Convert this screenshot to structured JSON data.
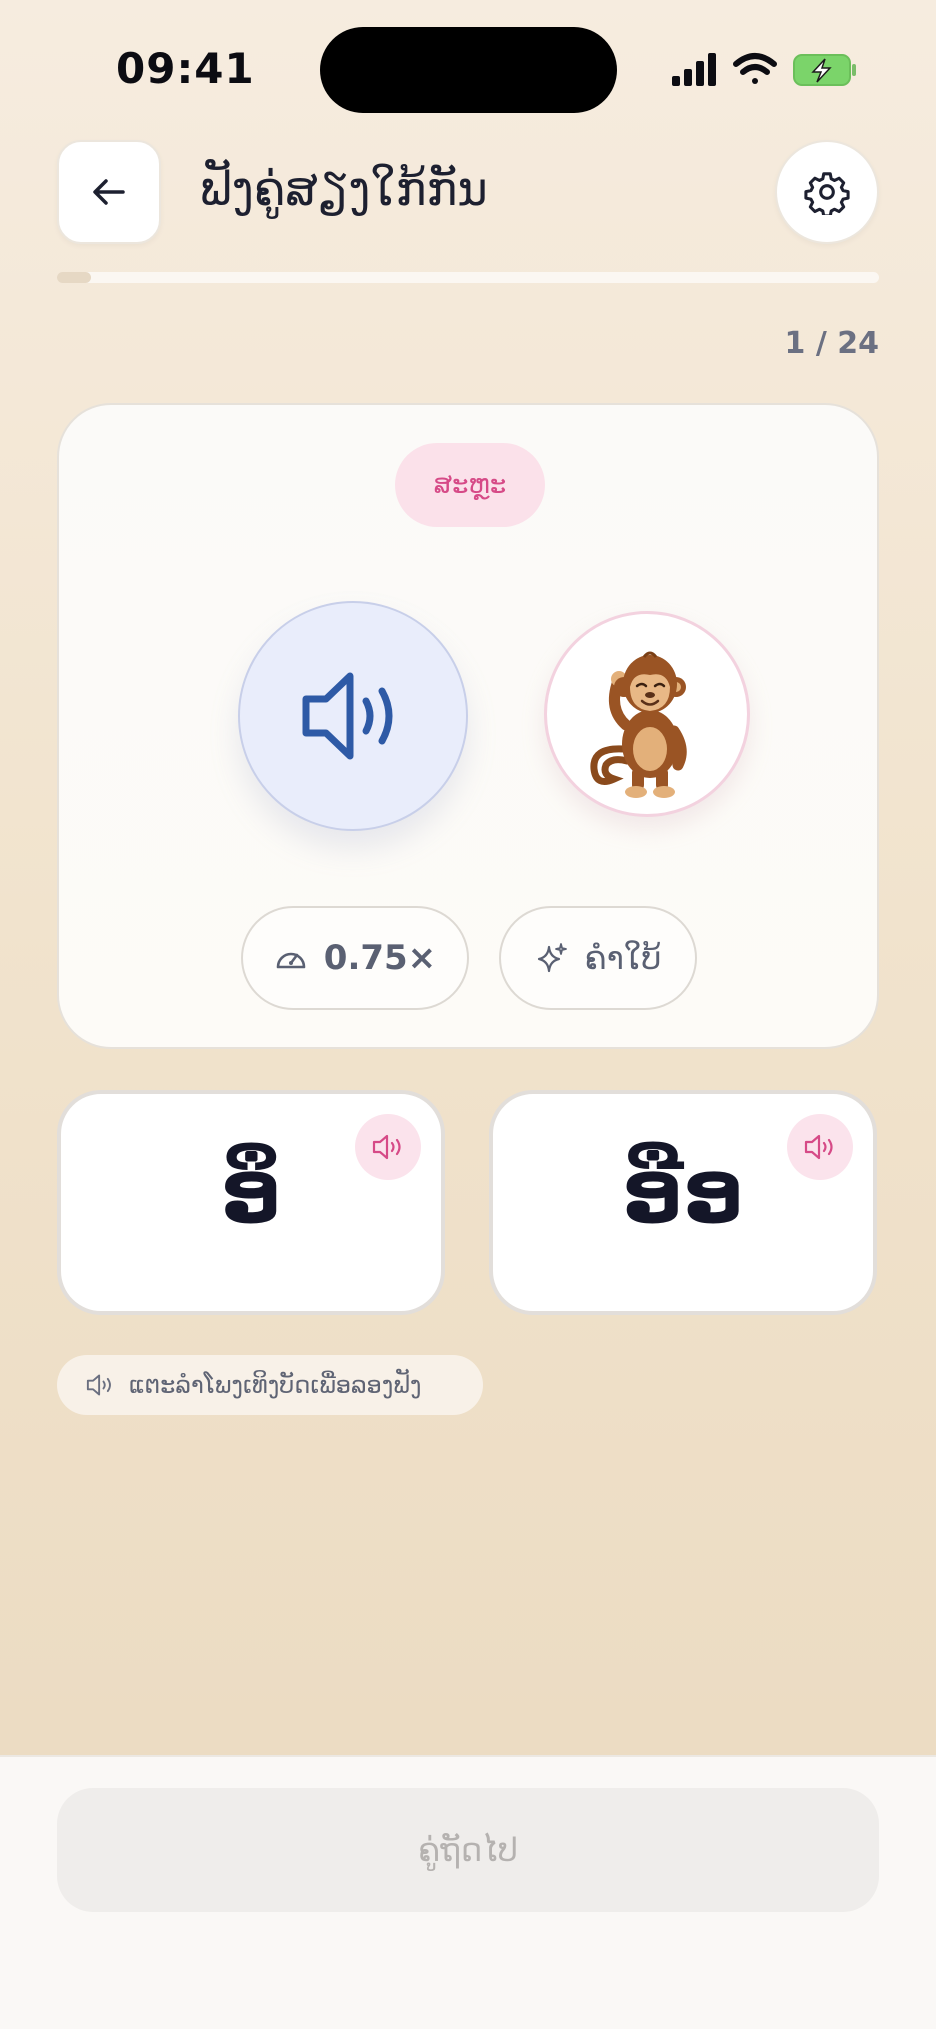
{
  "status_bar": {
    "time": "09:41"
  },
  "header": {
    "title": "ຟັງຄູ່ສຽງໃກ້ກັນ"
  },
  "progress": {
    "current": 1,
    "total": 24,
    "label": "1 / 24"
  },
  "card": {
    "tag": "ສະຫຼະ",
    "speed_label": "0.75×",
    "hint_label": "ຄຳໃບ້"
  },
  "answers": [
    {
      "text": "ອຶ"
    },
    {
      "text": "ອືອ"
    }
  ],
  "tip": {
    "text": "ແຕະລຳໂພງເທິງບັດເພື່ອລອງຟັງ"
  },
  "footer": {
    "next_label": "ຄູ່ຖັດໄປ"
  },
  "colors": {
    "accent_pink": "#d64a87",
    "accent_blue": "#2e5aa6",
    "disabled_text": "#b5b2b0"
  },
  "icons": [
    "back-arrow-icon",
    "gear-icon",
    "speaker-icon",
    "speedometer-icon",
    "sparkle-icon",
    "monkey-illustration"
  ]
}
